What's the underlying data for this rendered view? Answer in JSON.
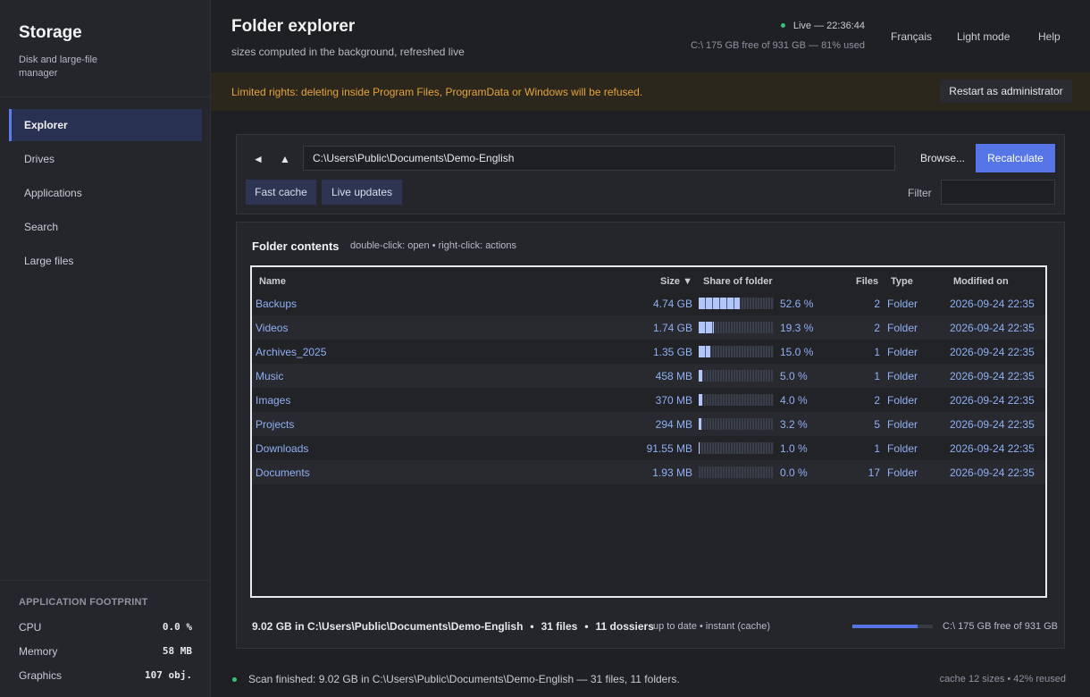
{
  "app": {
    "title": "Storage",
    "subtitle": "Disk and large-file manager"
  },
  "sidebar": {
    "items": [
      {
        "label": "Explorer",
        "active": true
      },
      {
        "label": "Drives"
      },
      {
        "label": "Applications"
      },
      {
        "label": "Search"
      },
      {
        "label": "Large files"
      }
    ]
  },
  "footprint": {
    "title": "APPLICATION FOOTPRINT",
    "rows": [
      {
        "label": "CPU",
        "value": "0.0 %"
      },
      {
        "label": "Memory",
        "value": "58 MB"
      },
      {
        "label": "Graphics",
        "value": "107 obj."
      }
    ]
  },
  "header": {
    "title": "Folder explorer",
    "subtitle": "sizes computed in the background, refreshed live",
    "live_status": "Live — 22:36:44",
    "disk_info": "C:\\ 175 GB free of 931 GB — 81% used",
    "links": [
      "Français",
      "Light mode",
      "Help"
    ]
  },
  "banner": {
    "text": "Limited rights: deleting inside Program Files, ProgramData or Windows will be refused.",
    "button": "Restart as administrator"
  },
  "toolbar": {
    "back_icon": "◄",
    "up_icon": "▲",
    "path": "C:\\Users\\Public\\Documents\\Demo-English",
    "browse_label": "Browse...",
    "recalc_label": "Recalculate",
    "chips": [
      "Fast cache",
      "Live updates"
    ],
    "filter_label": "Filter",
    "filter_value": ""
  },
  "contents": {
    "title": "Folder contents",
    "hint": "double-click: open • right-click: actions",
    "columns": {
      "name": "Name",
      "size": "Size ▼",
      "share": "Share of folder",
      "files": "Files",
      "type": "Type",
      "modified": "Modified on"
    },
    "rows": [
      {
        "name": "Backups",
        "size": "4.74 GB",
        "share": 0.526,
        "pct": "52.6 %",
        "files": "2",
        "type": "Folder",
        "modified": "2026-09-24 22:35"
      },
      {
        "name": "Videos",
        "size": "1.74 GB",
        "share": 0.193,
        "pct": "19.3 %",
        "files": "2",
        "type": "Folder",
        "modified": "2026-09-24 22:35"
      },
      {
        "name": "Archives_2025",
        "size": "1.35 GB",
        "share": 0.15,
        "pct": "15.0 %",
        "files": "1",
        "type": "Folder",
        "modified": "2026-09-24 22:35"
      },
      {
        "name": "Music",
        "size": "458 MB",
        "share": 0.05,
        "pct": "5.0 %",
        "files": "1",
        "type": "Folder",
        "modified": "2026-09-24 22:35"
      },
      {
        "name": "Images",
        "size": "370 MB",
        "share": 0.04,
        "pct": "4.0 %",
        "files": "2",
        "type": "Folder",
        "modified": "2026-09-24 22:35"
      },
      {
        "name": "Projects",
        "size": "294 MB",
        "share": 0.032,
        "pct": "3.2 %",
        "files": "5",
        "type": "Folder",
        "modified": "2026-09-24 22:35"
      },
      {
        "name": "Downloads",
        "size": "91.55 MB",
        "share": 0.01,
        "pct": "1.0 %",
        "files": "1",
        "type": "Folder",
        "modified": "2026-09-24 22:35"
      },
      {
        "name": "Documents",
        "size": "1.93 MB",
        "share": 0.0,
        "pct": "0.0 %",
        "files": "17",
        "type": "Folder",
        "modified": "2026-09-24 22:35"
      }
    ],
    "summary": {
      "total": "9.02 GB in C:\\Users\\Public\\Documents\\Demo-English",
      "files": "31 files",
      "folders": "11 dossiers",
      "separator": "•",
      "status": "up to date • instant (cache)",
      "disk_used_fraction": 0.81,
      "disk": "C:\\ 175 GB free of 931 GB"
    }
  },
  "statusbar": {
    "text": "Scan finished: 9.02 GB in C:\\Users\\Public\\Documents\\Demo-English — 31 files, 11 folders.",
    "cache": "cache 12 sizes • 42% reused"
  },
  "colors": {
    "accent": "#5676e8",
    "warning": "#e3a43b",
    "live": "#3ec07a",
    "link": "#8fb0f5"
  }
}
